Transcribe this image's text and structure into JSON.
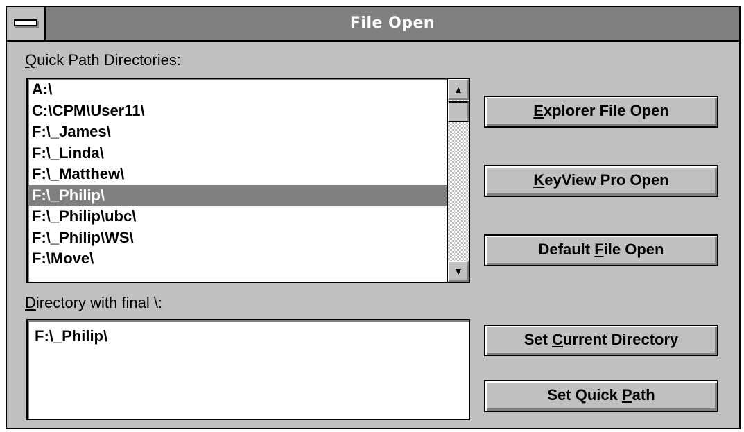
{
  "window": {
    "title": "File Open"
  },
  "quick_path": {
    "label_accel": "Q",
    "label_rest": "uick Path Directories:",
    "items": [
      "A:\\",
      "C:\\CPM\\User11\\",
      "F:\\_James\\",
      "F:\\_Linda\\",
      "F:\\_Matthew\\",
      "F:\\_Philip\\",
      "F:\\_Philip\\ubc\\",
      "F:\\_Philip\\WS\\",
      "F:\\Move\\"
    ],
    "selected_index": 5
  },
  "directory": {
    "label_accel": "D",
    "label_rest": "irectory with final \\:",
    "value": "F:\\_Philip\\"
  },
  "buttons": {
    "explorer": {
      "pre": "",
      "accel": "E",
      "post": "xplorer File Open"
    },
    "keyview": {
      "pre": "",
      "accel": "K",
      "post": "eyView Pro Open"
    },
    "default": {
      "pre": "Default ",
      "accel": "F",
      "post": "ile Open"
    },
    "set_current": {
      "pre": "Set ",
      "accel": "C",
      "post": "urrent Directory"
    },
    "set_quick": {
      "pre": "Set Quick ",
      "accel": "P",
      "post": "ath"
    }
  },
  "icons": {
    "system_menu": "system-menu-icon",
    "scroll_up": "scroll-up-arrow-icon",
    "scroll_down": "scroll-down-arrow-icon"
  },
  "colors": {
    "dialog_face": "#c0c0c0",
    "title_bar": "#808080",
    "selection": "#808080",
    "text": "#000000"
  }
}
